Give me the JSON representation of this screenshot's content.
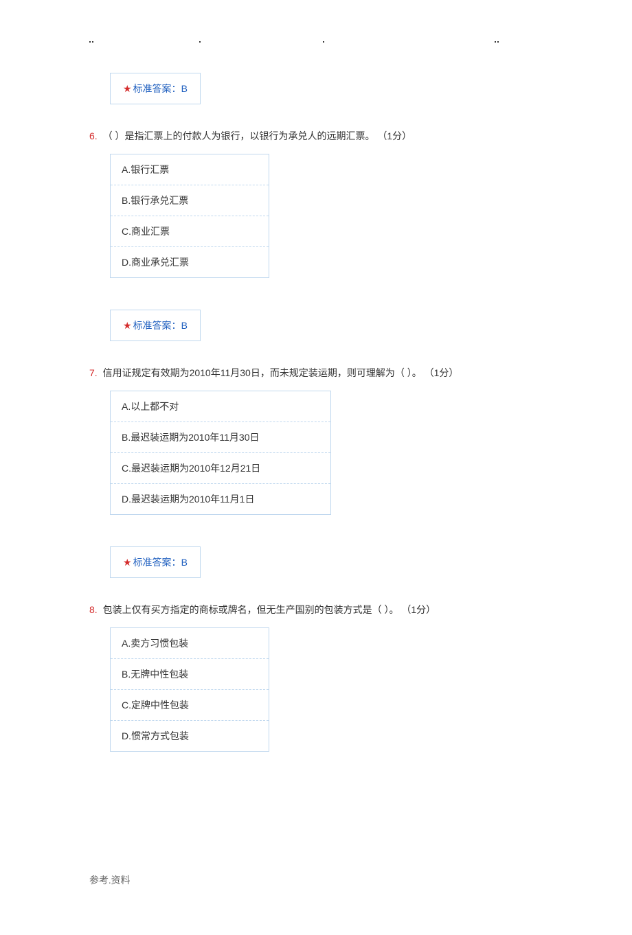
{
  "answers": {
    "label": "标准答案：",
    "a5": "B",
    "a6": "B",
    "a7": "B"
  },
  "q6": {
    "num": "6.",
    "text": "（  ）是指汇票上的付款人为银行，以银行为承兑人的远期汇票。  （1分）",
    "opts": {
      "a": "A.银行汇票",
      "b": "B.银行承兑汇票",
      "c": "C.商业汇票",
      "d": "D.商业承兑汇票"
    }
  },
  "q7": {
    "num": "7.",
    "text": "信用证规定有效期为2010年11月30日，而未规定装运期，则可理解为（  ）。  （1分）",
    "opts": {
      "a": "A.以上都不对",
      "b": "B.最迟装运期为2010年11月30日",
      "c": "C.最迟装运期为2010年12月21日",
      "d": "D.最迟装运期为2010年11月1日"
    }
  },
  "q8": {
    "num": "8.",
    "text": "包装上仅有买方指定的商标或牌名，但无生产国别的包装方式是（  ）。  （1分）",
    "opts": {
      "a": "A.卖方习惯包装",
      "b": "B.无牌中性包装",
      "c": "C.定牌中性包装",
      "d": "D.惯常方式包装"
    }
  },
  "footer": "参考.资料"
}
